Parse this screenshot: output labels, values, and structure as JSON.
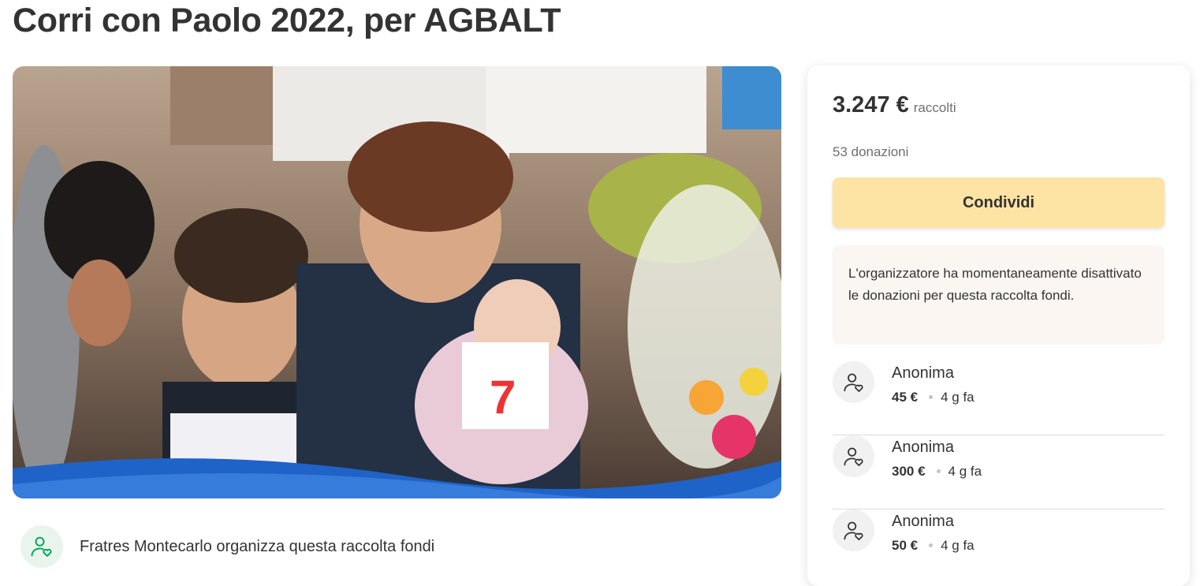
{
  "campaign": {
    "title": "Corri con Paolo 2022, per AGBALT",
    "organizer_text": "Fratres Montecarlo organizza questa raccolta fondi"
  },
  "donation_panel": {
    "raised_amount": "3.247 €",
    "raised_label": "raccolti",
    "donation_count": "53 donazioni",
    "share_label": "Condividi",
    "notice": "L'organizzatore ha momentaneamente disattivato le donazioni per questa raccolta fondi."
  },
  "donations": [
    {
      "name": "Anonima",
      "amount": "45 €",
      "time": "4 g fa"
    },
    {
      "name": "Anonima",
      "amount": "300 €",
      "time": "4 g fa"
    },
    {
      "name": "Anonima",
      "amount": "50 €",
      "time": "4 g fa"
    }
  ],
  "icons": {
    "organizer": "user-heart-icon",
    "donor": "user-heart-icon"
  },
  "colors": {
    "share_button_bg": "#fde3a4",
    "notice_bg": "#fbf6f1",
    "organizer_icon": "#02a95c",
    "text": "#333333"
  }
}
